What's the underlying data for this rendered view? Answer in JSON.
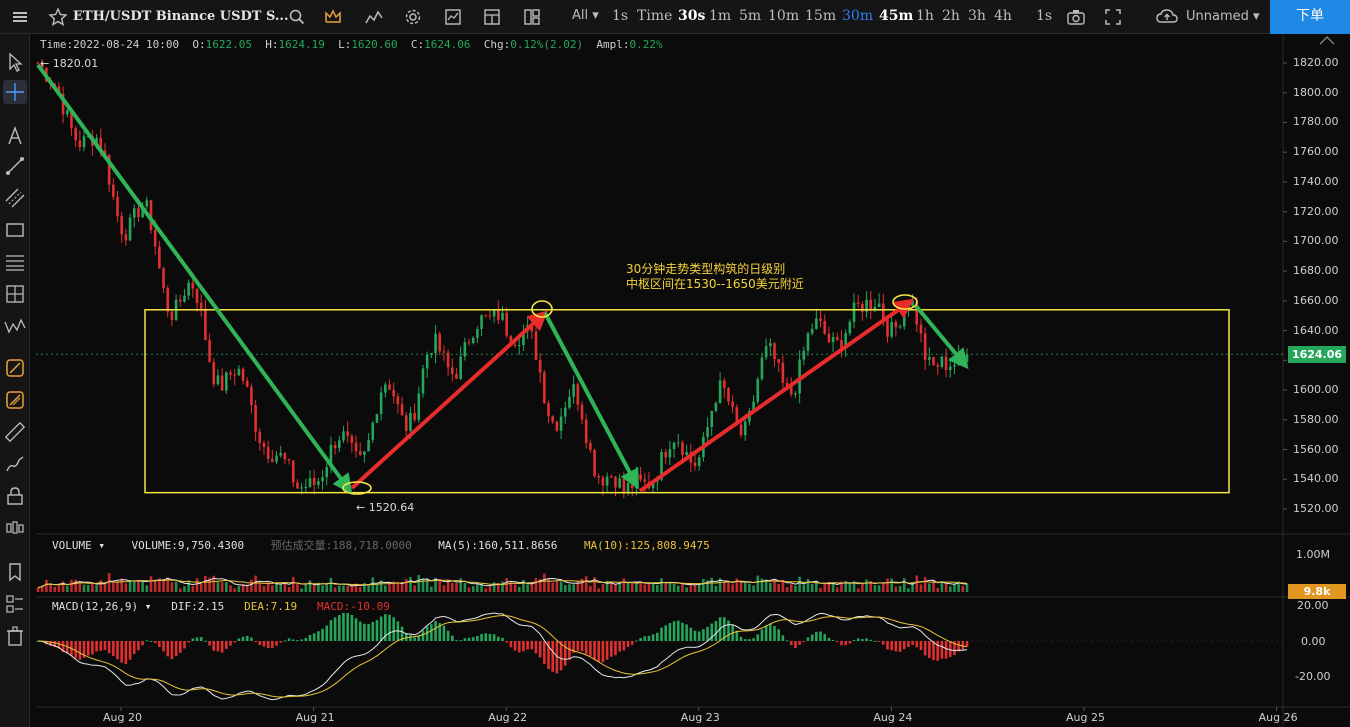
{
  "toolbar": {
    "symbol": "ETH/USDT Binance USDT S...",
    "range_all": "All",
    "timeframes": [
      "1s",
      "Time",
      "30s",
      "1m",
      "5m",
      "10m",
      "15m",
      "30m",
      "45m",
      "1h",
      "2h",
      "3h",
      "4h",
      "1s"
    ],
    "active_timeframe": "30m",
    "layout_name": "Unnamed",
    "order_button": "下单"
  },
  "ohlc": {
    "time_label": "Time:",
    "time": "2022-08-24 10:00",
    "open_label": "O:",
    "open": "1622.05",
    "high_label": "H:",
    "high": "1624.19",
    "low_label": "L:",
    "low": "1620.60",
    "close_label": "C:",
    "close": "1624.06",
    "chg_label": "Chg:",
    "chg": "0.12%(2.02)",
    "ampl_label": "Ampl:",
    "ampl": "0.22%"
  },
  "markers": {
    "high": "← 1820.01",
    "low": "← 1520.64"
  },
  "annotation": {
    "line1": "30分钟走势类型构筑的日级别",
    "line2": "中枢区间在1530--1650美元附近"
  },
  "price_axis": {
    "ticks": [
      "1820.00",
      "1800.00",
      "1780.00",
      "1760.00",
      "1740.00",
      "1720.00",
      "1700.00",
      "1680.00",
      "1660.00",
      "1640.00",
      "1620.00",
      "1600.00",
      "1580.00",
      "1560.00",
      "1540.00",
      "1520.00"
    ],
    "current": "1624.06",
    "current_color": "#26a65b"
  },
  "volume": {
    "name": "VOLUME",
    "label": "VOLUME:",
    "value": "9,750.4300",
    "est_label": "预估成交量:",
    "est_value": "188,718.0000",
    "ma5_label": "MA(5):",
    "ma5": "160,511.8656",
    "ma10_label": "MA(10):",
    "ma10": "125,808.9475",
    "axis_tick": "1.00M",
    "current": "9.8k",
    "current_color": "#e0961f"
  },
  "macd": {
    "name": "MACD(12,26,9)",
    "dif_label": "DIF:",
    "dif": "2.15",
    "dea_label": "DEA:",
    "dea": "7.19",
    "macd_label": "MACD:",
    "macd": "-10.09",
    "ticks": [
      "20.00",
      "0.00",
      "-20.00"
    ]
  },
  "time_axis": [
    "Aug 20",
    "Aug 21",
    "Aug 22",
    "Aug 23",
    "Aug 24",
    "Aug 25",
    "Aug 26"
  ],
  "colors": {
    "up": "#26a65b",
    "down": "#e03030",
    "box": "#f5e642",
    "arrow_up": "#e82c2c",
    "arrow_down": "#2fb457"
  },
  "chart_data": {
    "type": "candlestick",
    "symbol": "ETH/USDT",
    "ylim": [
      1510,
      1830
    ],
    "pivots": [
      {
        "x": "Aug 19 20:00",
        "price": 1820.0
      },
      {
        "x": "Aug 21 04:30",
        "price": 1533.0
      },
      {
        "x": "Aug 22 05:30",
        "price": 1652.0
      },
      {
        "x": "Aug 22 21:00",
        "price": 1531.0
      },
      {
        "x": "Aug 24 04:30",
        "price": 1661.0
      },
      {
        "x": "Aug 24 12:30",
        "price": 1618.0
      }
    ],
    "zone": {
      "x_start": "Aug 20 06:00",
      "x_end": "Aug 25 17:00",
      "low": 1531,
      "high": 1654
    },
    "last_close": 1624.06
  }
}
